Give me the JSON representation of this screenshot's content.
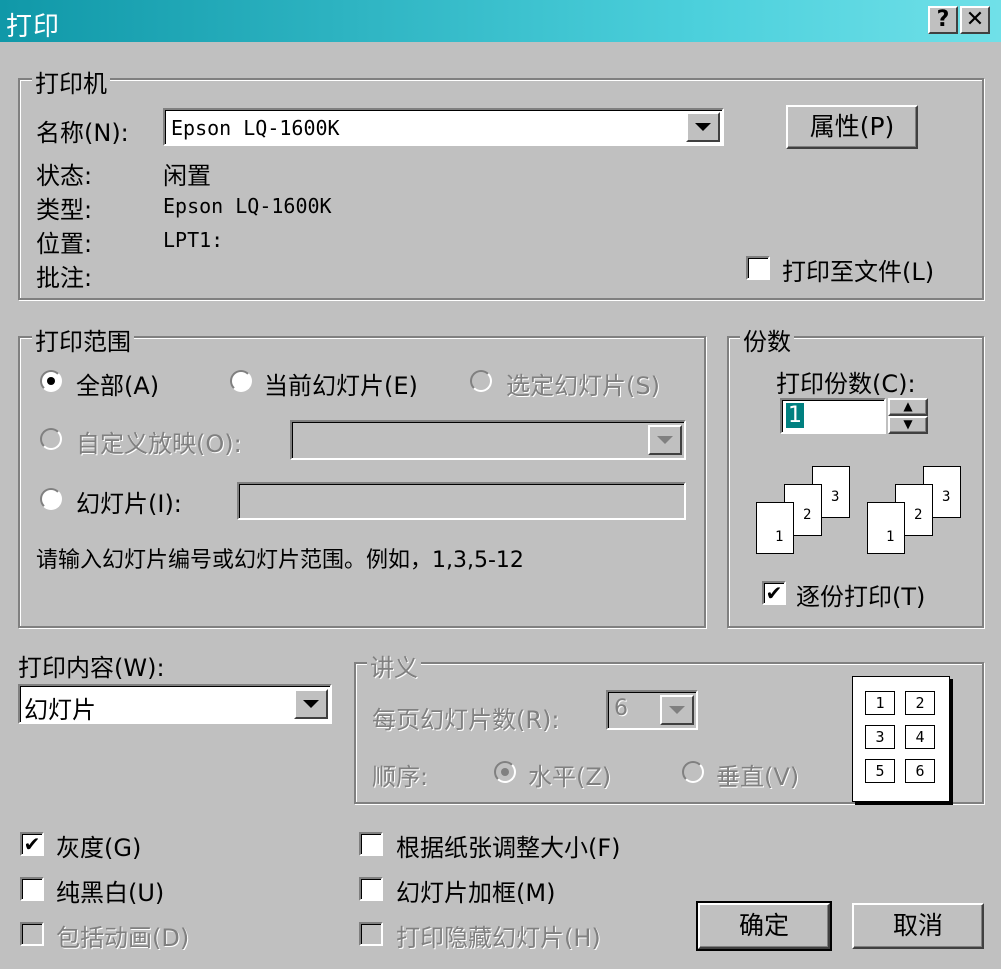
{
  "window": {
    "title": "打印",
    "help_btn": "?",
    "close_btn": "✕"
  },
  "printer": {
    "legend": "打印机",
    "name_label": "名称(N):",
    "name_value": "Epson LQ-1600K",
    "properties_btn": "属性(P)",
    "status_label": "状态:",
    "status_value": "闲置",
    "type_label": "类型:",
    "type_value": "Epson LQ-1600K",
    "location_label": "位置:",
    "location_value": "LPT1:",
    "comment_label": "批注:",
    "print_to_file": "打印至文件(L)",
    "print_to_file_checked": false
  },
  "range": {
    "legend": "打印范围",
    "all": "全部(A)",
    "current_slide": "当前幻灯片(E)",
    "selection": "选定幻灯片(S)",
    "custom_show": "自定义放映(O):",
    "slides": "幻灯片(I):",
    "hint": "请输入幻灯片编号或幻灯片范围。例如，1,3,5-12",
    "selected": "all"
  },
  "copies": {
    "legend": "份数",
    "count_label": "打印份数(C):",
    "count_value": "1",
    "collate": "逐份打印(T)",
    "collate_checked": true,
    "page_numbers": [
      "1",
      "2",
      "3"
    ]
  },
  "content": {
    "label": "打印内容(W):",
    "value": "幻灯片"
  },
  "handouts": {
    "legend": "讲义",
    "per_page_label": "每页幻灯片数(R):",
    "per_page_value": "6",
    "order_label": "顺序:",
    "horizontal": "水平(Z)",
    "vertical": "垂直(V)",
    "preview_numbers": [
      "1",
      "2",
      "3",
      "4",
      "5",
      "6"
    ]
  },
  "options": {
    "grayscale": "灰度(G)",
    "grayscale_checked": true,
    "pure_bw": "纯黑白(U)",
    "include_animations": "包括动画(D)",
    "scale_to_fit": "根据纸张调整大小(F)",
    "frame_slides": "幻灯片加框(M)",
    "print_hidden": "打印隐藏幻灯片(H)"
  },
  "buttons": {
    "ok": "确定",
    "cancel": "取消"
  }
}
